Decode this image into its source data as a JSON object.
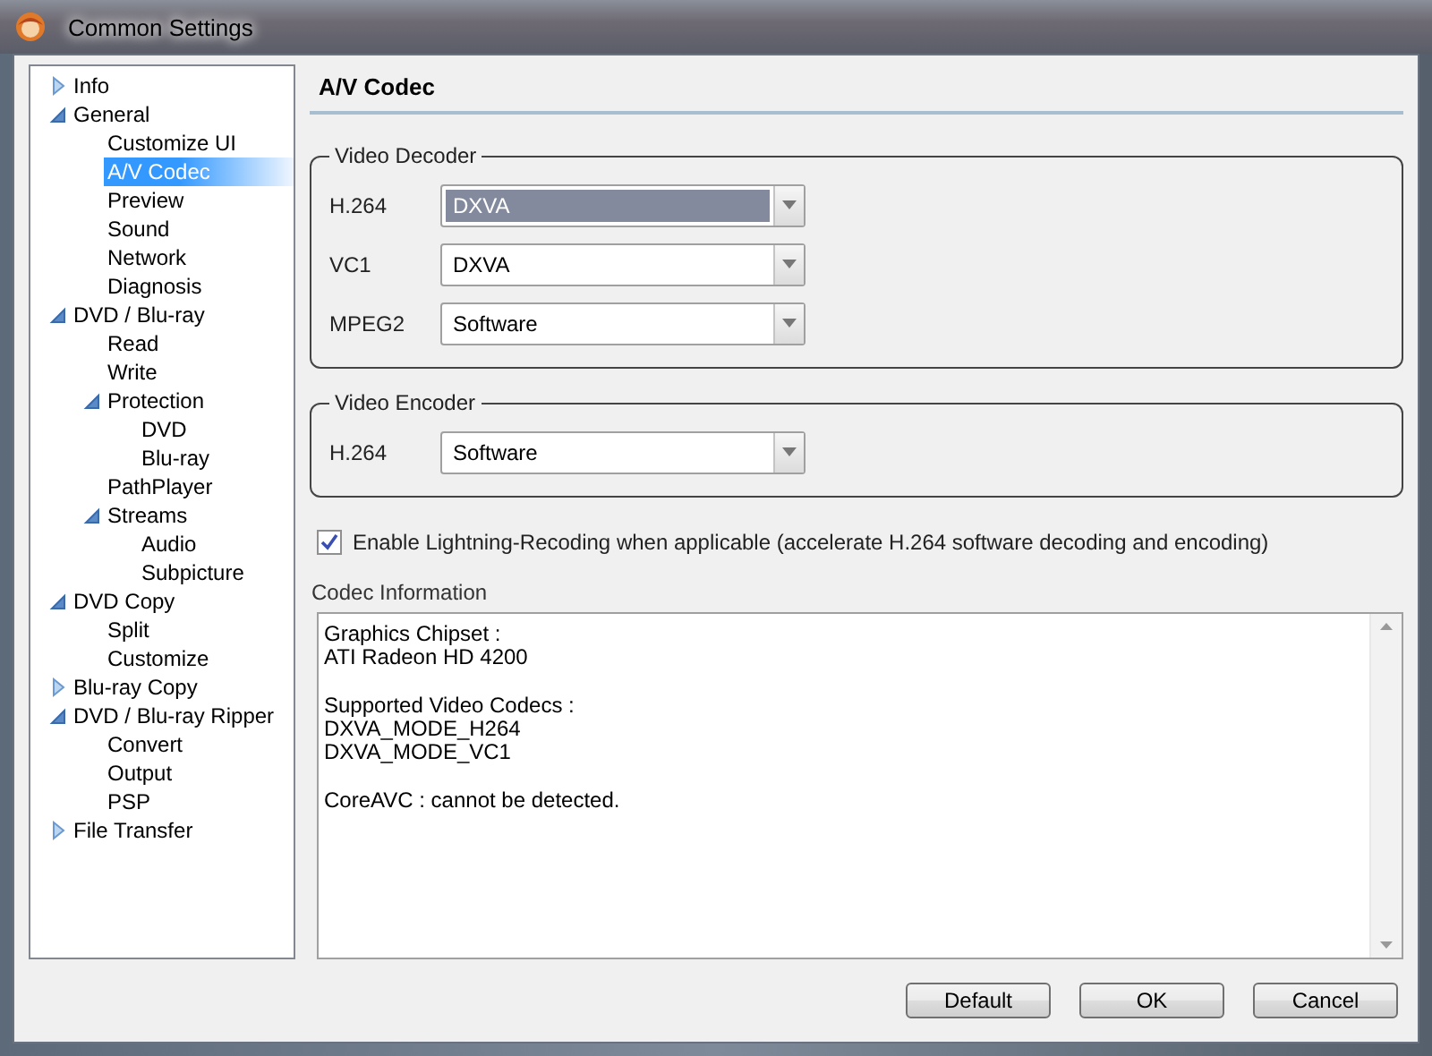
{
  "window": {
    "title": "Common Settings"
  },
  "tree": [
    {
      "label": "Info",
      "expanded": false,
      "selected": false
    },
    {
      "label": "General",
      "expanded": true,
      "selected": false,
      "children": [
        {
          "label": "Customize UI",
          "selected": false
        },
        {
          "label": "A/V Codec",
          "selected": true
        },
        {
          "label": "Preview",
          "selected": false
        },
        {
          "label": "Sound",
          "selected": false
        },
        {
          "label": "Network",
          "selected": false
        },
        {
          "label": "Diagnosis",
          "selected": false
        }
      ]
    },
    {
      "label": "DVD / Blu-ray",
      "expanded": true,
      "selected": false,
      "children": [
        {
          "label": "Read",
          "selected": false
        },
        {
          "label": "Write",
          "selected": false
        },
        {
          "label": "Protection",
          "expanded": true,
          "selected": false,
          "children": [
            {
              "label": "DVD",
              "selected": false
            },
            {
              "label": "Blu-ray",
              "selected": false
            }
          ]
        },
        {
          "label": "PathPlayer",
          "selected": false
        },
        {
          "label": "Streams",
          "expanded": true,
          "selected": false,
          "children": [
            {
              "label": "Audio",
              "selected": false
            },
            {
              "label": "Subpicture",
              "selected": false
            }
          ]
        }
      ]
    },
    {
      "label": "DVD Copy",
      "expanded": true,
      "selected": false,
      "children": [
        {
          "label": "Split",
          "selected": false
        },
        {
          "label": "Customize",
          "selected": false
        }
      ]
    },
    {
      "label": "Blu-ray Copy",
      "expanded": false,
      "selected": false
    },
    {
      "label": "DVD / Blu-ray Ripper",
      "expanded": true,
      "selected": false,
      "children": [
        {
          "label": "Convert",
          "selected": false
        },
        {
          "label": "Output",
          "selected": false
        },
        {
          "label": "PSP",
          "selected": false
        }
      ]
    },
    {
      "label": "File Transfer",
      "expanded": false,
      "selected": false
    }
  ],
  "page_title": "A/V Codec",
  "groups": [
    {
      "title": "Video Decoder",
      "rows": [
        {
          "label": "H.264",
          "value": "DXVA",
          "focused": true
        },
        {
          "label": "VC1",
          "value": "DXVA",
          "focused": false
        },
        {
          "label": "MPEG2",
          "value": "Software",
          "focused": false
        }
      ]
    },
    {
      "title": "Video Encoder",
      "rows": [
        {
          "label": "H.264",
          "value": "Software",
          "focused": false
        }
      ]
    }
  ],
  "lightning_recoding": {
    "label": "Enable Lightning-Recoding when applicable (accelerate H.264 software decoding and encoding)",
    "checked": true
  },
  "codec_information": {
    "label": "Codec Information",
    "paragraphs": [
      [
        "Graphics Chipset :",
        "ATI Radeon HD 4200"
      ],
      [
        "Supported Video Codecs :",
        "DXVA_MODE_H264",
        "DXVA_MODE_VC1"
      ],
      [
        "CoreAVC : cannot be detected."
      ]
    ]
  },
  "buttons": [
    "Default",
    "OK",
    "Cancel"
  ]
}
